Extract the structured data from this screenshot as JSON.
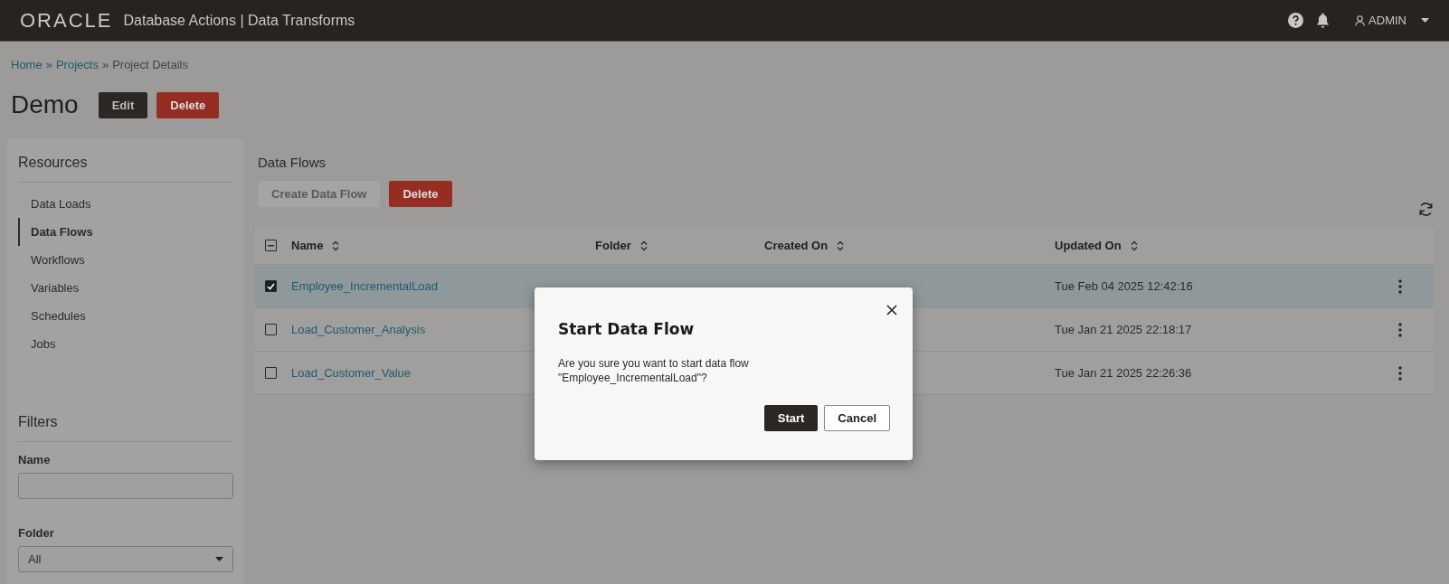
{
  "header": {
    "logo": "ORACLE",
    "title": "Database Actions | Data Transforms",
    "user": "ADMIN"
  },
  "breadcrumb": [
    {
      "label": "Home",
      "link": true
    },
    {
      "label": "Projects",
      "link": true
    },
    {
      "label": "Project Details",
      "link": false
    }
  ],
  "breadcrumb_separator": "»",
  "project": {
    "title": "Demo",
    "buttons": [
      {
        "label": "Edit",
        "kind": "dark"
      },
      {
        "label": "Delete",
        "kind": "danger"
      }
    ]
  },
  "sidebar": {
    "title": "Resources",
    "items": [
      {
        "label": "Data Loads",
        "selected": false
      },
      {
        "label": "Data Flows",
        "selected": true
      },
      {
        "label": "Workflows",
        "selected": false
      },
      {
        "label": "Variables",
        "selected": false
      },
      {
        "label": "Schedules",
        "selected": false
      },
      {
        "label": "Jobs",
        "selected": false
      }
    ]
  },
  "filters": {
    "title": "Filters",
    "name": {
      "label": "Name"
    },
    "folder": {
      "label": "Folder",
      "value": "All"
    }
  },
  "data_flows": {
    "title": "Data Flows",
    "buttons": [
      {
        "label": "Create Data Flow",
        "kind": "plain",
        "disabled": true
      },
      {
        "label": "Delete",
        "kind": "danger",
        "disabled": false
      }
    ],
    "table": {
      "select_all": {
        "indeterminate": true
      },
      "columns": [
        "Name",
        "Folder",
        "Created On",
        "Updated On"
      ],
      "rows": [
        {
          "name": "Employee_IncrementalLoad",
          "updated_on": "Tue Feb 04 2025 12:42:16",
          "selected": true
        },
        {
          "name": "Load_Customer_Analysis",
          "updated_on": "Tue Jan 21 2025 22:18:17",
          "selected": false
        },
        {
          "name": "Load_Customer_Value",
          "updated_on": "Tue Jan 21 2025 22:26:36",
          "selected": false
        }
      ]
    }
  },
  "dialog": {
    "title": "Start Data Flow",
    "message": "Are you sure you want to start data flow \"Employee_IncrementalLoad\"?",
    "buttons": [
      {
        "label": "Start",
        "kind": "primary"
      },
      {
        "label": "Cancel",
        "kind": "secondary"
      }
    ]
  }
}
